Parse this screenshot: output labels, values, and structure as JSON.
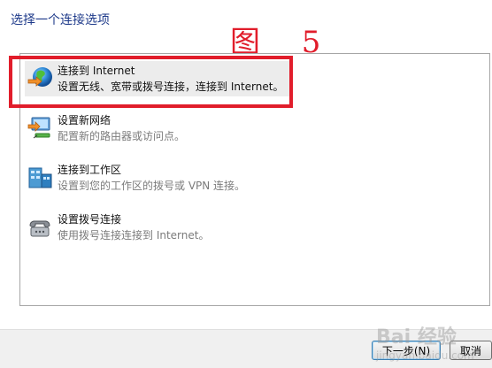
{
  "header": {
    "title": "选择一个连接选项",
    "annotation": "图 5"
  },
  "options": [
    {
      "title": "连接到 Internet",
      "description": "设置无线、宽带或拨号连接，连接到 Internet。",
      "icon": "globe-connect-icon",
      "selected": true
    },
    {
      "title": "设置新网络",
      "description": "配置新的路由器或访问点。",
      "icon": "router-network-icon",
      "selected": false
    },
    {
      "title": "连接到工作区",
      "description": "设置到您的工作区的拨号或 VPN 连接。",
      "icon": "workplace-vpn-icon",
      "selected": false
    },
    {
      "title": "设置拨号连接",
      "description": "使用拨号连接连接到 Internet。",
      "icon": "dialup-phone-icon",
      "selected": false
    }
  ],
  "footer": {
    "next_label": "下一步(N)",
    "cancel_label": "取消"
  },
  "watermark": {
    "text": "Bai",
    "suffix": "经验",
    "small": "jingyan.baidu.com"
  },
  "colors": {
    "header_text": "#1e3a8a",
    "annotation": "#e11d2b",
    "highlight_box": "#e11d2b",
    "selected_bg": "#ececec"
  }
}
